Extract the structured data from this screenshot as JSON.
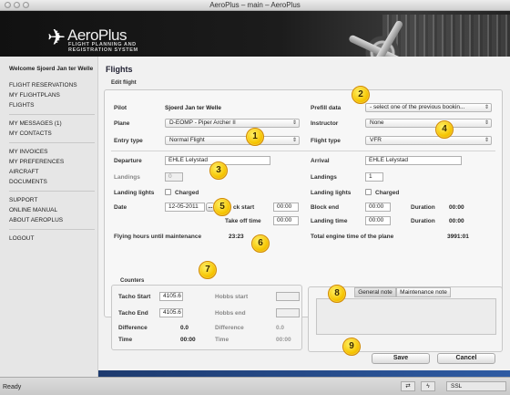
{
  "window": {
    "title": "AeroPlus – main – AeroPlus"
  },
  "brand": {
    "name": "AeroPlus",
    "tagline1": "FLIGHT PLANNING AND",
    "tagline2": "REGISTRATION SYSTEM"
  },
  "sidebar": {
    "welcome": "Welcome Sjoerd Jan ter Welle",
    "group1": [
      "FLIGHT RESERVATIONS",
      "MY FLIGHTPLANS",
      "FLIGHTS"
    ],
    "messages": "MY MESSAGES (1)",
    "contacts": "MY CONTACTS",
    "group3": [
      "MY INVOICES",
      "MY PREFERENCES",
      "AIRCRAFT",
      "DOCUMENTS"
    ],
    "group4": [
      "SUPPORT",
      "ONLINE MANUAL",
      "ABOUT AEROPLUS"
    ],
    "logout": "LOGOUT"
  },
  "main": {
    "title": "Flights",
    "edit_group": "Edit flight",
    "pilot_label": "Pilot",
    "pilot_value": "Sjoerd Jan ter Welle",
    "prefill_label": "Prefill data",
    "prefill_value": "- select one of the previous bookin...",
    "plane_label": "Plane",
    "plane_value": "D-EOMP - Piper Archer II",
    "instructor_label": "Instructor",
    "instructor_value": "None",
    "entry_type_label": "Entry type",
    "entry_type_value": "Normal Flight",
    "flight_type_label": "Flight type",
    "flight_type_value": "VFR",
    "departure_label": "Departure",
    "departure_value": "EHLE Lelystad",
    "arrival_label": "Arrival",
    "arrival_value": "EHLE Lelystad",
    "landings_label_left": "Landings",
    "landings_value_left": "0",
    "landings_label_right": "Landings",
    "landings_value_right": "1",
    "landing_lights_left": "Landing lights",
    "charged_left": "Charged",
    "landing_lights_right": "Landing lights",
    "charged_right": "Charged",
    "date_label": "Date",
    "date_value": "12-05-2011",
    "date_btn": "...",
    "block_start_label": "ck start",
    "block_start_value": "00:00",
    "take_off_label": "Take off time",
    "take_off_value": "00:00",
    "block_end_label": "Block end",
    "block_end_value": "00:00",
    "duration1_label": "Duration",
    "duration1_value": "00:00",
    "landing_time_label": "Landing time",
    "landing_time_value": "00:00",
    "duration2_label": "Duration",
    "duration2_value": "00:00",
    "maint_label": "Flying hours until maintenance",
    "maint_value": "23:23",
    "engine_label": "Total engine time of the plane",
    "engine_value": "3991:01",
    "counters_group": "Counters",
    "tacho_start_label": "Tacho Start",
    "tacho_start_value": "4105.6",
    "hobbs_start_label": "Hobbs start",
    "tacho_end_label": "Tacho End",
    "tacho_end_value": "4105.6",
    "hobbs_end_label": "Hobbs end",
    "diff_label": "Difference",
    "diff_value": "0.0",
    "diff2_label": "Difference",
    "diff2_value": "0.0",
    "time_label": "Time",
    "time_value": "00:00",
    "time2_label": "Time",
    "time2_value": "00:00",
    "tab_general": "General note",
    "tab_maintenance": "Maintenance note",
    "save_label": "Save",
    "cancel_label": "Cancel"
  },
  "callouts": [
    "1",
    "2",
    "3",
    "4",
    "5",
    "6",
    "7",
    "8",
    "9"
  ],
  "status": {
    "left": "Ready",
    "ssl": "SSL"
  }
}
